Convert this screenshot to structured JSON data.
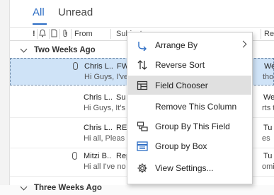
{
  "tabs": {
    "all": "All",
    "unread": "Unread"
  },
  "columns": {
    "importance": "!",
    "from": "From",
    "subject": "Subject",
    "received": "Re"
  },
  "groups": [
    "Two Weeks Ago",
    "Three Weeks Ago"
  ],
  "rows": [
    {
      "from": "Chris L...",
      "subject": "FW",
      "preview": "Hi Guys, I've",
      "day": "We",
      "preview_right": "those",
      "attachment": true,
      "selected": true
    },
    {
      "from": "Chris L...",
      "subject": "Su",
      "preview": "Hi Guys, It's",
      "day": "We",
      "preview_right": "rts that",
      "attachment": false,
      "selected": false
    },
    {
      "from": "Chris L...",
      "subject": "RE",
      "preview": "Hi all, Pleas",
      "day": "Tu",
      "preview_right": "es",
      "attachment": false,
      "selected": false
    },
    {
      "from": "Mitzi B...",
      "subject": "Rep",
      "preview": "Hi all  I've no",
      "day": "Tu",
      "preview_right": "oming",
      "attachment": true,
      "selected": false
    }
  ],
  "context_menu": {
    "items": [
      {
        "label": "Arrange By",
        "icon": "arrange-by-icon",
        "submenu": true
      },
      {
        "label": "Reverse Sort",
        "icon": "reverse-sort-icon",
        "submenu": false
      },
      {
        "label": "Field Chooser",
        "icon": "field-chooser-icon",
        "submenu": false,
        "highlighted": true
      },
      {
        "label": "Remove This Column",
        "icon": "",
        "submenu": false
      },
      {
        "label": "Group By This Field",
        "icon": "group-by-field-icon",
        "submenu": false
      },
      {
        "label": "Group by Box",
        "icon": "group-by-box-icon",
        "submenu": false
      },
      {
        "label": "View Settings...",
        "icon": "view-settings-icon",
        "submenu": false
      }
    ]
  },
  "colors": {
    "accent": "#2b6cc4",
    "selected_row": "#cfe3f7",
    "menu_highlight": "#e0e0e0"
  }
}
